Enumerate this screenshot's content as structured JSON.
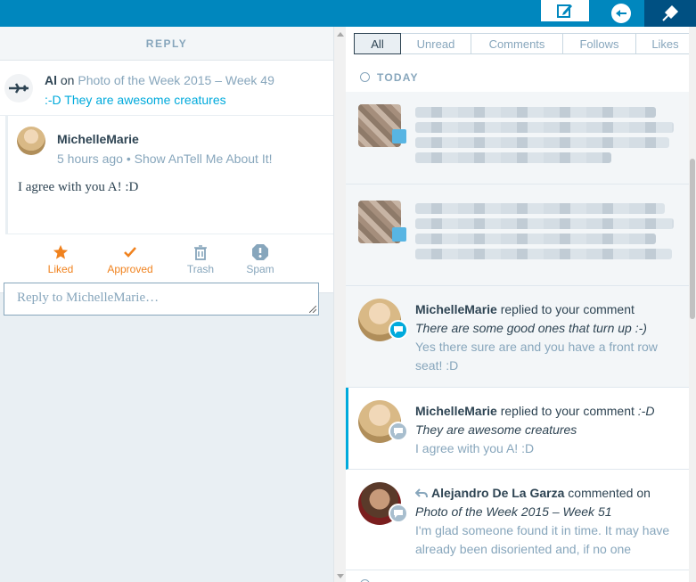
{
  "reply_panel": {
    "header": "REPLY",
    "parent": {
      "author": "Al",
      "on": "on",
      "post": "Photo of the Week 2015 – Week 49",
      "text": ":-D They are awesome creatures"
    },
    "comment": {
      "author": "MichelleMarie",
      "meta": "5 hours ago • Show AnTell Me About It!",
      "text": "I agree with you A! :D"
    },
    "actions": [
      {
        "label": "Liked",
        "icon": "star-icon"
      },
      {
        "label": "Approved",
        "icon": "check-icon"
      },
      {
        "label": "Trash",
        "icon": "trash-icon"
      },
      {
        "label": "Spam",
        "icon": "spam-icon"
      }
    ],
    "reply_placeholder": "Reply to MichelleMarie…"
  },
  "filters": [
    "All",
    "Unread",
    "Comments",
    "Follows",
    "Likes"
  ],
  "section_today": "TODAY",
  "notifications": [
    {
      "author": "MichelleMarie",
      "action": "replied to your comment",
      "quote": "There are some good ones that turn up :-)",
      "excerpt": "Yes there sure are and you have a front row seat! :D"
    },
    {
      "author": "MichelleMarie",
      "action": "replied to your comment",
      "quote_prefix": ":-D",
      "quote": "They are awesome creatures",
      "excerpt": "I agree with you A! :D"
    },
    {
      "author": "Alejandro De La Garza",
      "action": "commented on",
      "quote": "Photo of the Week 2015 – Week 51",
      "excerpt": "I'm glad someone found it in time. It may have already been disoriented and, if no one"
    }
  ],
  "colors": {
    "topbar": "#0087be",
    "accent": "#00aadc",
    "orange": "#f0821e",
    "muted": "#87a6bc"
  }
}
